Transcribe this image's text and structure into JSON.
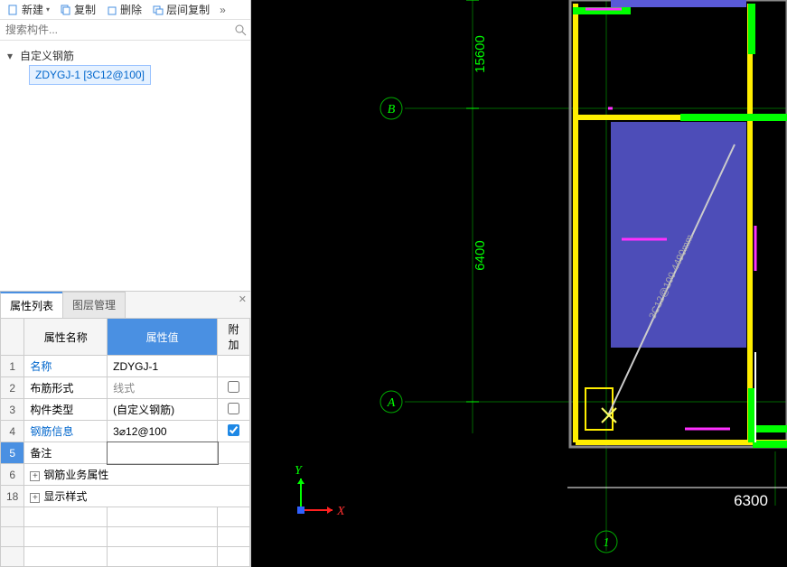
{
  "toolbar": {
    "new": "新建",
    "copy": "复制",
    "delete": "删除",
    "floor_copy": "层间复制"
  },
  "search": {
    "placeholder": "搜索构件..."
  },
  "tree": {
    "root": "自定义钢筋",
    "item": "ZDYGJ-1 [3C12@100]"
  },
  "tabs": {
    "prop": "属性列表",
    "layer": "图层管理"
  },
  "prop_header": {
    "name": "属性名称",
    "value": "属性值",
    "extra": "附加"
  },
  "rows": {
    "r1": {
      "n": "1",
      "name": "名称",
      "val": "ZDYGJ-1"
    },
    "r2": {
      "n": "2",
      "name": "布筋形式",
      "val": "线式"
    },
    "r3": {
      "n": "3",
      "name": "构件类型",
      "val": "(自定义钢筋)"
    },
    "r4": {
      "n": "4",
      "name": "钢筋信息",
      "val": "3⌀12@100"
    },
    "r5": {
      "n": "5",
      "name": "备注",
      "val": ""
    },
    "r6": {
      "n": "6",
      "name": "钢筋业务属性"
    },
    "r18": {
      "n": "18",
      "name": "显示样式"
    }
  },
  "drawing": {
    "dim_top": "15600",
    "dim_mid": "6400",
    "dim_right": "6300",
    "grid_b": "B",
    "grid_a": "A",
    "grid_1": "1",
    "axis_x": "X",
    "axis_y": "Y",
    "rebar_label": "3C12@100  4490mm"
  },
  "chart_data": {
    "type": "table",
    "title": "属性列表",
    "rows": [
      {
        "属性名称": "名称",
        "属性值": "ZDYGJ-1",
        "附加": false
      },
      {
        "属性名称": "布筋形式",
        "属性值": "线式",
        "附加": false
      },
      {
        "属性名称": "构件类型",
        "属性值": "(自定义钢筋)",
        "附加": false
      },
      {
        "属性名称": "钢筋信息",
        "属性值": "3⌀12@100",
        "附加": true
      },
      {
        "属性名称": "备注",
        "属性值": "",
        "附加": null
      },
      {
        "属性名称": "钢筋业务属性",
        "属性值": null,
        "附加": null
      },
      {
        "属性名称": "显示样式",
        "属性值": null,
        "附加": null
      }
    ]
  }
}
